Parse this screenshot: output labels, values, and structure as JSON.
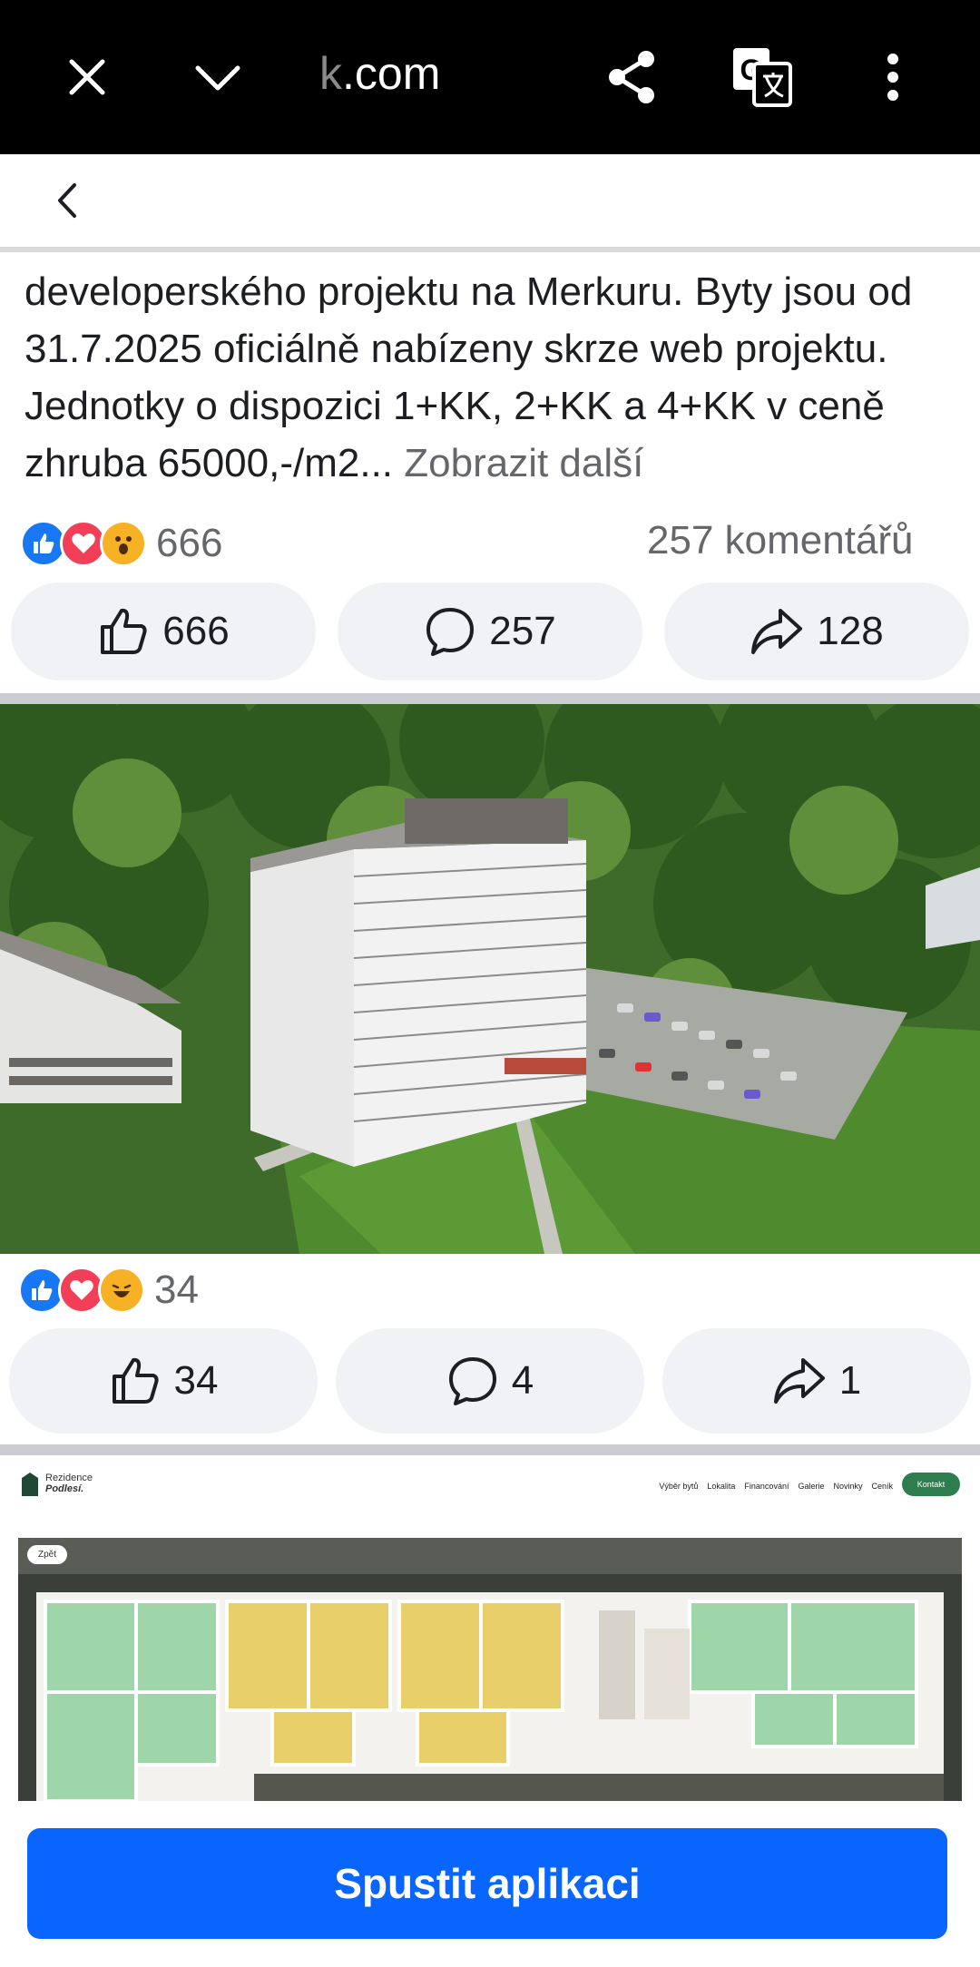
{
  "browser": {
    "url_faded": "k",
    "url_rest": ".com",
    "icons": [
      "close-icon",
      "chevron-down-icon",
      "share-icon",
      "translate-icon",
      "more-vertical-icon"
    ]
  },
  "post1": {
    "text": "developerského projektu na Merkuru. Byty jsou od 31.7.2025 oficiálně nabízeny skrze web projektu. Jednotky o dispozici 1+KK, 2+KK a 4+KK v ceně zhruba 65000,-/m2...",
    "see_more": "Zobrazit další",
    "reaction_count": "666",
    "comments_summary": "257 komentářů",
    "like_count": "666",
    "comment_count": "257",
    "share_count": "128"
  },
  "post2": {
    "reaction_count": "34",
    "like_count": "34",
    "comment_count": "4",
    "share_count": "1"
  },
  "website": {
    "brand_line1": "Rezidence",
    "brand_line2": "Podlesí.",
    "nav_links": [
      "Výběr bytů",
      "Lokalita",
      "Financování",
      "Galerie",
      "Novinky",
      "Ceník"
    ],
    "contact_button": "Kontakt",
    "back_button": "Zpět"
  },
  "cta": {
    "label": "Spustit aplikaci"
  },
  "colors": {
    "accent": "#0866ff",
    "pill_bg": "#f0f2f5",
    "muted_text": "#65676b"
  }
}
